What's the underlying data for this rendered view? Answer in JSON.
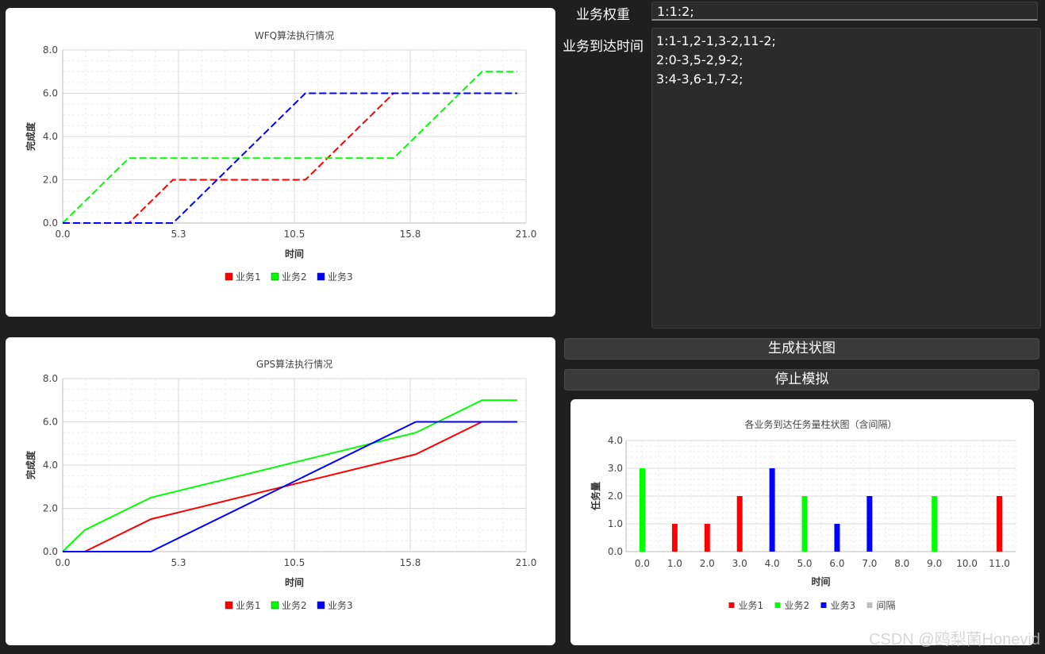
{
  "form": {
    "weights_label": "业务权重",
    "weights_value": "1:1:2;",
    "arrivals_label": "业务到达时间",
    "arrivals_value": "1:1-1,2-1,3-2,11-2;\n2:0-3,5-2,9-2;\n3:4-3,6-1,7-2;"
  },
  "buttons": {
    "generate": "生成柱状图",
    "stop": "停止模拟"
  },
  "watermark": "CSDN @鸥梨菌Honevid",
  "colors": {
    "s1": "#ff0000",
    "s2": "#00ff00",
    "s3": "#0000ff",
    "gap": "#bdbdbd",
    "window_bg": "#1f1f1f",
    "field_bg": "#2b2b2b"
  },
  "chart_data": [
    {
      "type": "line",
      "title": "WFQ算法执行情况",
      "xlabel": "时间",
      "ylabel": "完成度",
      "xlim": [
        0,
        21
      ],
      "ylim": [
        0,
        8
      ],
      "xticks": [
        "0.0",
        "5.3",
        "10.5",
        "15.8",
        "21.0"
      ],
      "yticks": [
        "0.0",
        "2.0",
        "4.0",
        "6.0",
        "8.0"
      ],
      "line_style": "dashed",
      "legend": "bottom",
      "series": [
        {
          "name": "业务1",
          "color": "#ff0000",
          "points": [
            [
              0,
              0
            ],
            [
              3,
              0
            ],
            [
              5,
              2
            ],
            [
              11,
              2
            ],
            [
              15,
              6
            ]
          ]
        },
        {
          "name": "业务2",
          "color": "#00ff00",
          "points": [
            [
              0,
              0
            ],
            [
              3,
              3
            ],
            [
              15,
              3
            ],
            [
              19,
              7
            ],
            [
              20.6,
              7
            ]
          ]
        },
        {
          "name": "业务3",
          "color": "#0000ff",
          "points": [
            [
              0,
              0
            ],
            [
              5,
              0
            ],
            [
              11,
              6
            ],
            [
              20.6,
              6
            ]
          ]
        }
      ]
    },
    {
      "type": "line",
      "title": "GPS算法执行情况",
      "xlabel": "时间",
      "ylabel": "完成度",
      "xlim": [
        0,
        21
      ],
      "ylim": [
        0,
        8
      ],
      "xticks": [
        "0.0",
        "5.3",
        "10.5",
        "15.8",
        "21.0"
      ],
      "yticks": [
        "0.0",
        "2.0",
        "4.0",
        "6.0",
        "8.0"
      ],
      "line_style": "solid",
      "legend": "bottom",
      "series": [
        {
          "name": "业务1",
          "color": "#ff0000",
          "points": [
            [
              1,
              0
            ],
            [
              4,
              1.5
            ],
            [
              16,
              4.5
            ],
            [
              19,
              6
            ],
            [
              20.6,
              6
            ]
          ]
        },
        {
          "name": "业务2",
          "color": "#00ff00",
          "points": [
            [
              0,
              0
            ],
            [
              1,
              1
            ],
            [
              4,
              2.5
            ],
            [
              16,
              5.5
            ],
            [
              19,
              7
            ],
            [
              20.6,
              7
            ]
          ]
        },
        {
          "name": "业务3",
          "color": "#0000ff",
          "points": [
            [
              0,
              0
            ],
            [
              4,
              0
            ],
            [
              16,
              6
            ],
            [
              20.6,
              6
            ]
          ]
        }
      ]
    },
    {
      "type": "bar",
      "title": "各业务到达任务量柱状图（含间隔）",
      "xlabel": "时间",
      "ylabel": "任务量",
      "categories": [
        "0.0",
        "1.0",
        "2.0",
        "3.0",
        "4.0",
        "5.0",
        "6.0",
        "7.0",
        "8.0",
        "9.0",
        "10.0",
        "11.0"
      ],
      "ylim": [
        0,
        4
      ],
      "yticks": [
        "0.0",
        "1.0",
        "2.0",
        "3.0",
        "4.0"
      ],
      "legend": "bottom",
      "series": [
        {
          "name": "业务1",
          "color": "#ff0000",
          "values": [
            0,
            1,
            1,
            2,
            0,
            0,
            0,
            0,
            0,
            0,
            0,
            2
          ]
        },
        {
          "name": "业务2",
          "color": "#00ff00",
          "values": [
            3,
            0,
            0,
            0,
            0,
            2,
            0,
            0,
            0,
            2,
            0,
            0
          ]
        },
        {
          "name": "业务3",
          "color": "#0000ff",
          "values": [
            0,
            0,
            0,
            0,
            3,
            0,
            1,
            2,
            0,
            0,
            0,
            0
          ]
        },
        {
          "name": "间隔",
          "color": "#bdbdbd",
          "values": [
            0,
            0,
            0,
            0,
            0,
            0,
            0,
            0,
            0,
            0,
            0,
            0
          ]
        }
      ]
    }
  ]
}
